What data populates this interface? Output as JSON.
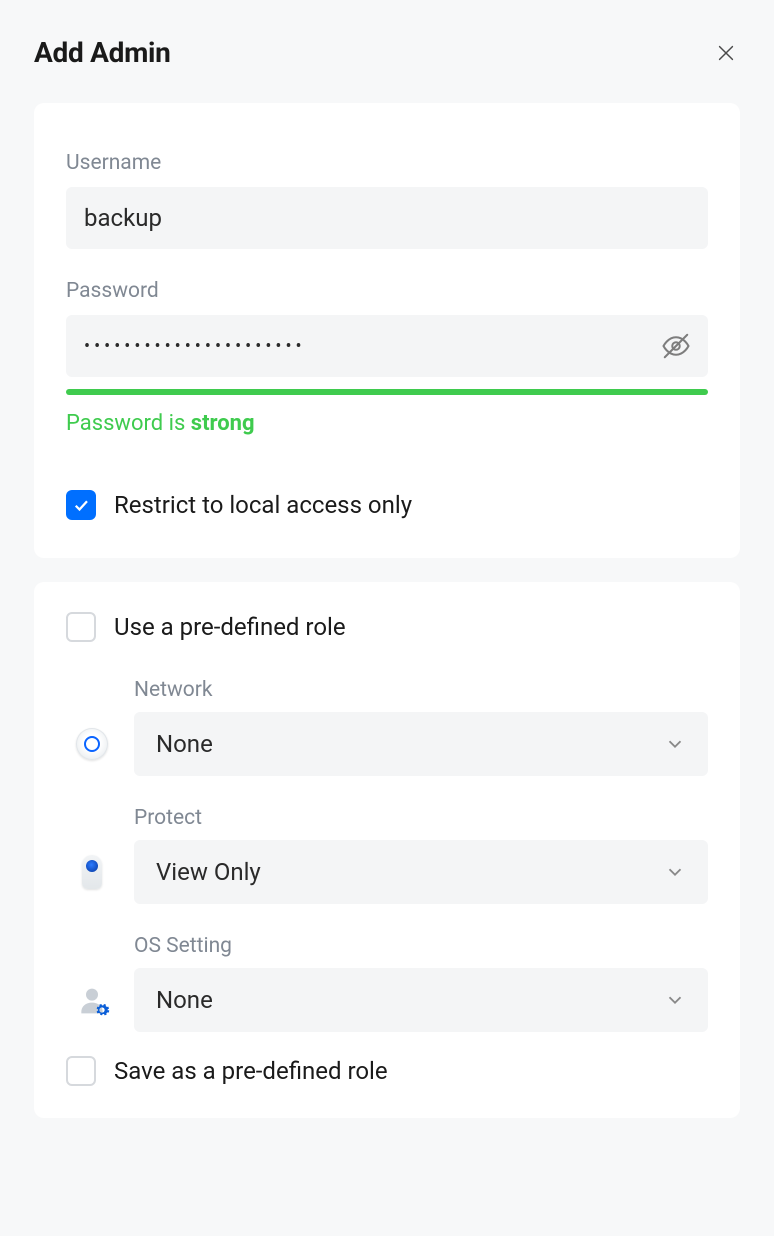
{
  "dialog": {
    "title": "Add Admin"
  },
  "form": {
    "username_label": "Username",
    "username_value": "backup",
    "password_label": "Password",
    "password_value": "••••••••••••••••••••••",
    "strength_prefix": "Password is ",
    "strength_word": "strong",
    "restrict_label": "Restrict to local access only",
    "restrict_checked": true
  },
  "roles": {
    "use_predefined_label": "Use a pre-defined role",
    "use_predefined_checked": false,
    "permissions": [
      {
        "id": "network",
        "label": "Network",
        "value": "None"
      },
      {
        "id": "protect",
        "label": "Protect",
        "value": "View Only"
      },
      {
        "id": "os",
        "label": "OS Setting",
        "value": "None"
      }
    ],
    "save_predefined_label": "Save as a pre-defined role",
    "save_predefined_checked": false
  },
  "colors": {
    "accent": "#006fff",
    "success": "#3fcb4e"
  }
}
